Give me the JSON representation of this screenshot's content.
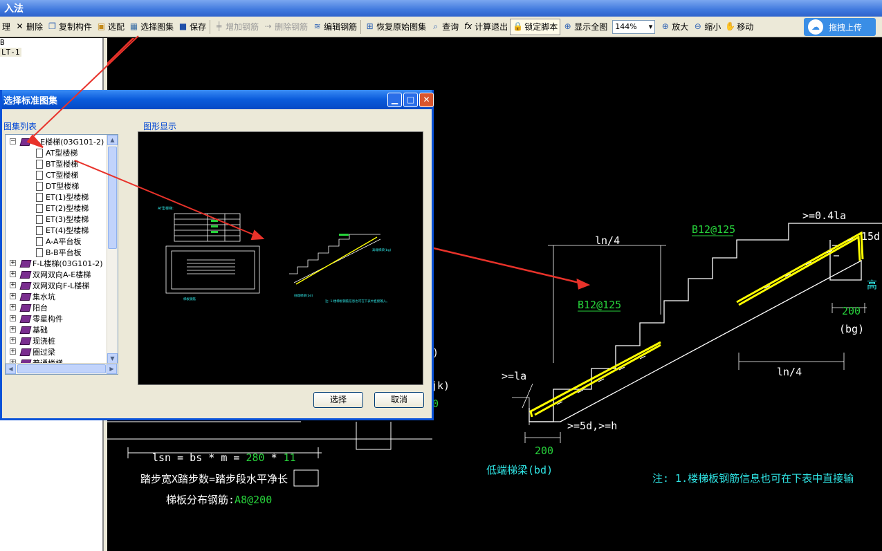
{
  "app": {
    "title": "入法"
  },
  "toolbar": {
    "items": [
      {
        "label": "理",
        "icon": "edit-icon"
      },
      {
        "label": "删除",
        "icon": "delete-icon"
      },
      {
        "label": "复制构件",
        "icon": "copy-icon"
      },
      {
        "label": "选配",
        "icon": "select-config-icon"
      },
      {
        "label": "选择图集",
        "icon": "atlas-icon"
      },
      {
        "label": "保存",
        "icon": "save-icon"
      },
      {
        "label": "增加钢筋",
        "icon": "add-rebar-icon",
        "disabled": true
      },
      {
        "label": "删除钢筋",
        "icon": "remove-rebar-icon",
        "disabled": true
      },
      {
        "label": "编辑钢筋",
        "icon": "edit-rebar-icon"
      },
      {
        "label": "恢复原始图集",
        "icon": "restore-icon"
      },
      {
        "label": "查询",
        "icon": "query-icon"
      },
      {
        "label": "计算退出",
        "icon": "formula-icon"
      },
      {
        "label": "锁定脚本",
        "icon": "lock-icon",
        "pressed": true
      },
      {
        "label": "显示全图",
        "icon": "fit-view-icon"
      }
    ],
    "zoom": "144%",
    "zoom_items": [
      {
        "label": "放大",
        "icon": "zoom-in-icon"
      },
      {
        "label": "缩小",
        "icon": "zoom-out-icon"
      },
      {
        "label": "移动",
        "icon": "pan-icon"
      }
    ],
    "upload_label": "拖拽上传"
  },
  "left_tree": {
    "items": [
      "B",
      "LT-1"
    ]
  },
  "dialog": {
    "title": "选择标准图集",
    "list_label": "图集列表",
    "preview_label": "图形显示",
    "ok_label": "选择",
    "cancel_label": "取消",
    "tree": [
      {
        "label": "A-E楼梯(03G101-2)",
        "level": 0,
        "expanded": true,
        "icon": "book-open"
      },
      {
        "label": "AT型楼梯",
        "level": 1
      },
      {
        "label": "BT型楼梯",
        "level": 1
      },
      {
        "label": "CT型楼梯",
        "level": 1
      },
      {
        "label": "DT型楼梯",
        "level": 1
      },
      {
        "label": "ET(1)型楼梯",
        "level": 1
      },
      {
        "label": "ET(2)型楼梯",
        "level": 1
      },
      {
        "label": "ET(3)型楼梯",
        "level": 1
      },
      {
        "label": "ET(4)型楼梯",
        "level": 1
      },
      {
        "label": "A-A平台板",
        "level": 1
      },
      {
        "label": "B-B平台板",
        "level": 1
      },
      {
        "label": "F-L楼梯(03G101-2)",
        "level": 0,
        "icon": "book"
      },
      {
        "label": "双网双向A-E楼梯",
        "level": 0,
        "icon": "book"
      },
      {
        "label": "双网双向F-L楼梯",
        "level": 0,
        "icon": "book"
      },
      {
        "label": "集水坑",
        "level": 0,
        "icon": "book"
      },
      {
        "label": "阳台",
        "level": 0,
        "icon": "book"
      },
      {
        "label": "零星构件",
        "level": 0,
        "icon": "book"
      },
      {
        "label": "基础",
        "level": 0,
        "icon": "book"
      },
      {
        "label": "现浇桩",
        "level": 0,
        "icon": "book"
      },
      {
        "label": "圈过梁",
        "level": 0,
        "icon": "book"
      },
      {
        "label": "普通楼梯",
        "level": 0,
        "icon": "book"
      }
    ],
    "preview": {
      "title": "AT型楼梯:",
      "note": "注: 1.楼梯板钢筋信息也可在下表中直接输入。",
      "labels": [
        "梯板钢筋",
        "低端梯梁(bd)",
        "高端梯梁(bg)"
      ]
    }
  },
  "drawing": {
    "top_rebar": "B12@125",
    "bottom_rebar": "B12@125",
    "ln4_top": "ln/4",
    "ln4_bottom": "ln/4",
    "anchor_top": ">=0.4la",
    "anchor_bottom": ">=la",
    "dim_200_right": "200",
    "dim_200_left": "200",
    "bg_label": "(bg)",
    "fifteen_d": "15d",
    "high_char": "高",
    "five_d": ">=5d,>=h",
    "low_beam": "低端梯梁(bd)",
    "formula_prefix": "lsn = bs * m = ",
    "formula_bs": "280",
    "formula_times": " * ",
    "formula_m": "11",
    "formula_text": "踏步宽X踏步数=踏步段水平净长",
    "dist_prefix": "梯板分布钢筋:",
    "dist_value": "A8@200",
    "note": "注: 1.楼梯板钢筋信息也可在下表中直接输",
    "frag_1": ")",
    "frag_2": "jk)",
    "frag_3": "0"
  },
  "colors": {
    "cad_bg": "#000000",
    "rebar": "#ffff00",
    "dim_text": "#ffffff",
    "green_text": "#27d33b",
    "cyan_text": "#30e6e6",
    "arrow": "#e8322a"
  }
}
